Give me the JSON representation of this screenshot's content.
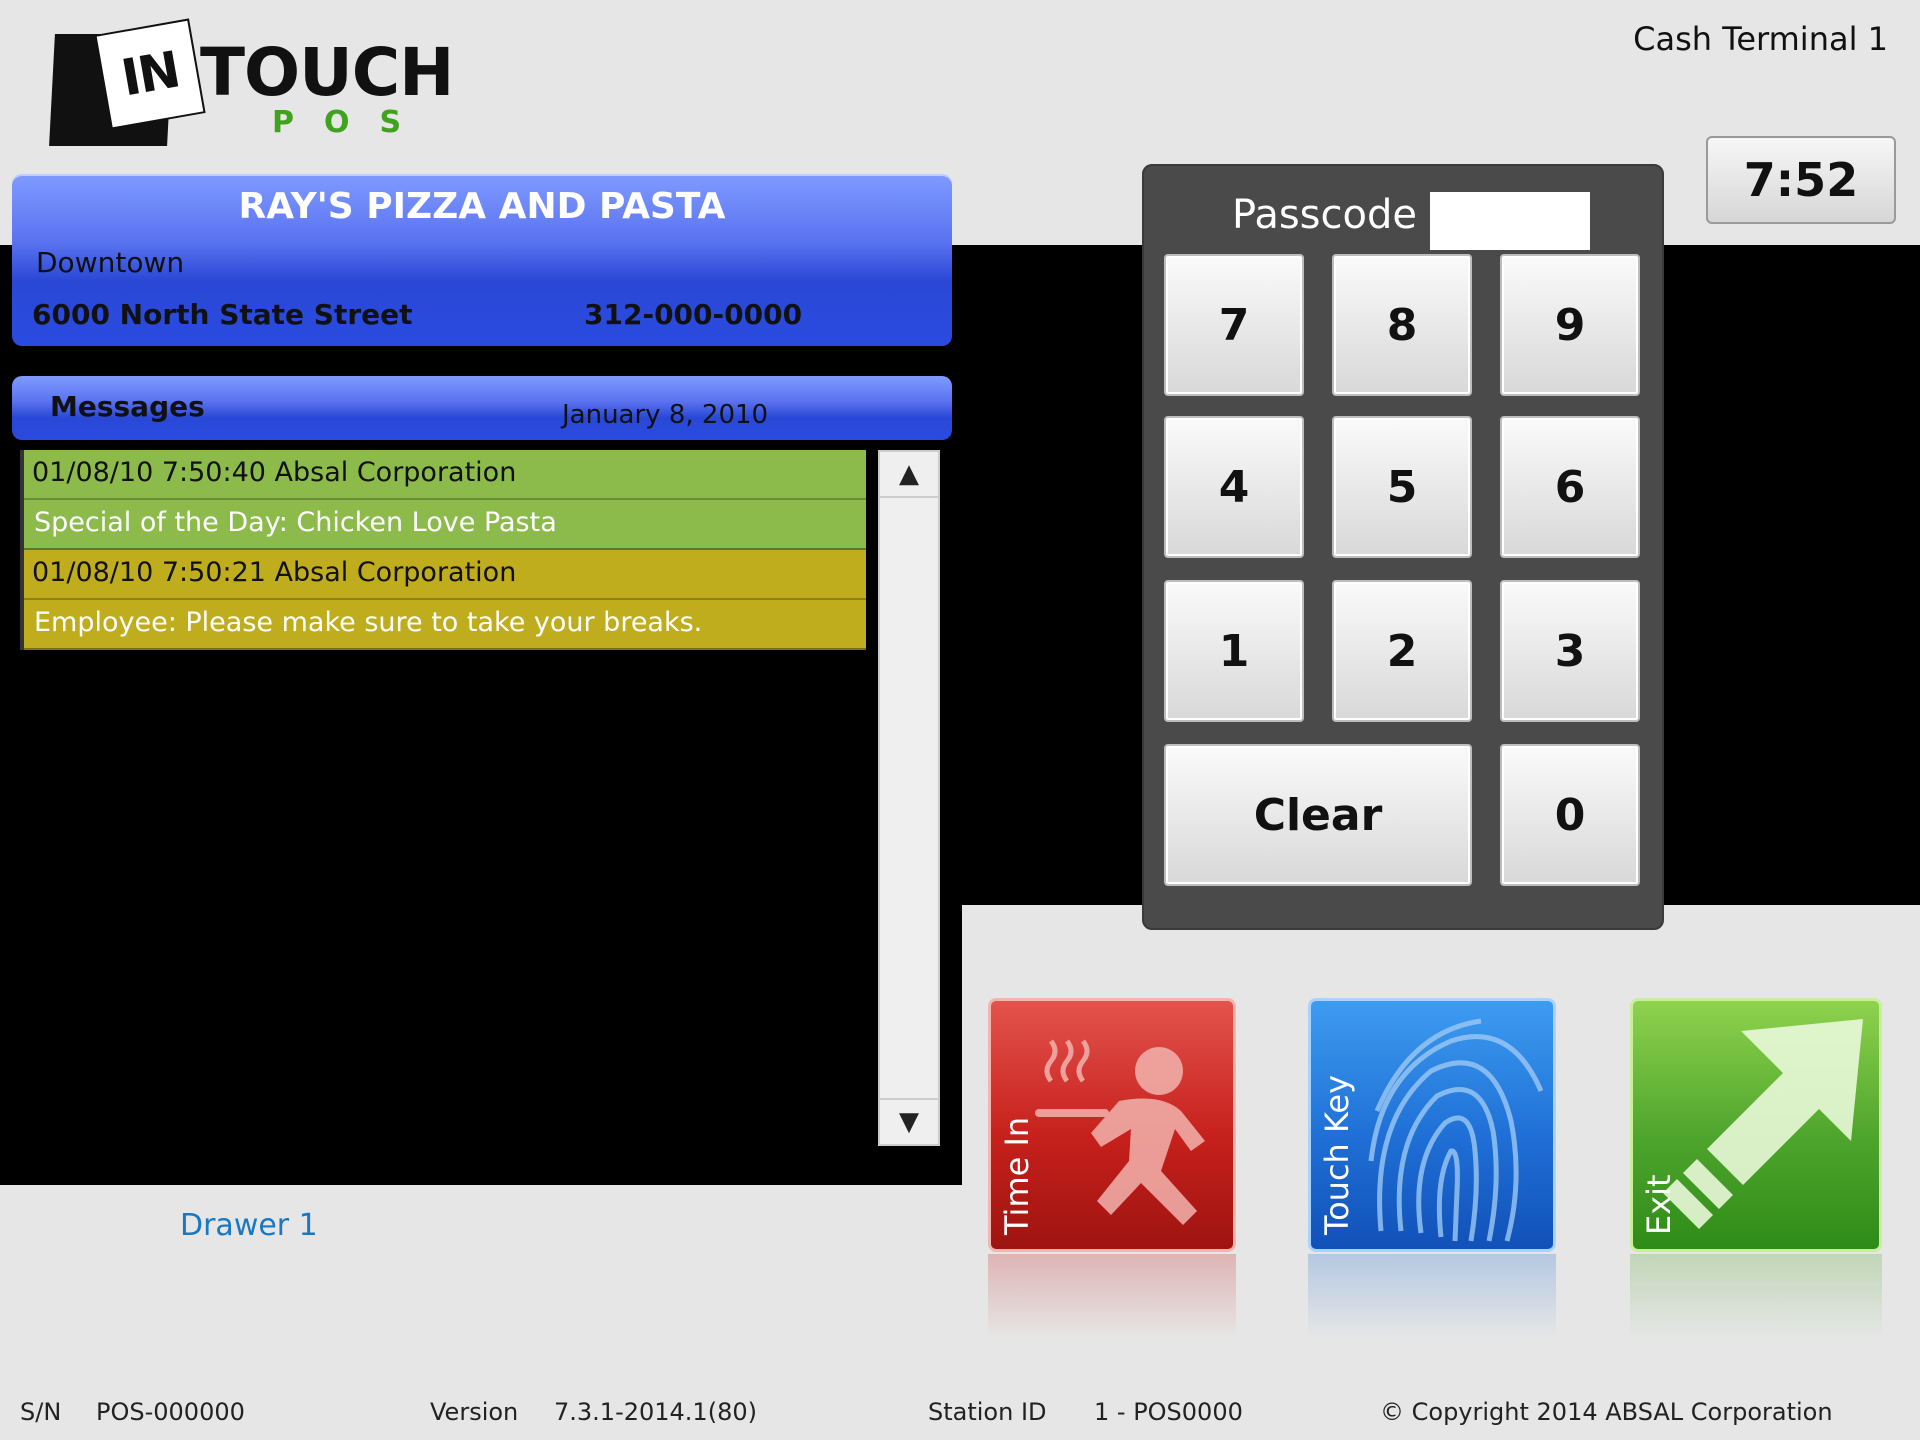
{
  "header": {
    "logo_in": "IN",
    "logo_touch": "TOUCH",
    "logo_pos": "POS",
    "terminal_name": "Cash Terminal 1",
    "clock": "7:52"
  },
  "store": {
    "name": "RAY'S PIZZA AND PASTA",
    "area": "Downtown",
    "address": "6000 North State Street",
    "phone": "312-000-0000"
  },
  "messages": {
    "title": "Messages",
    "date": "January 8, 2010",
    "items": [
      {
        "header": "01/08/10 7:50:40 Absal Corporation",
        "body": "Special of the Day:  Chicken Love Pasta",
        "color": "#8dbb4b"
      },
      {
        "header": "01/08/10 7:50:21 Absal Corporation",
        "body": "Employee:  Please make sure to take your breaks.",
        "color": "#c0ad1e"
      }
    ],
    "scroll_up": "▲",
    "scroll_down": "▼"
  },
  "drawer": "Drawer 1",
  "keypad": {
    "label": "Passcode",
    "value": "",
    "keys": [
      "7",
      "8",
      "9",
      "4",
      "5",
      "6",
      "1",
      "2",
      "3"
    ],
    "clear": "Clear",
    "zero": "0"
  },
  "actions": {
    "time_in": "Time In",
    "touch_key": "Touch Key",
    "exit": "Exit",
    "colors": {
      "time_in": "#c6201c",
      "touch_key": "#1f6fd6",
      "exit": "#4ea52c"
    }
  },
  "footer": {
    "sn_label": "S/N",
    "sn_value": "POS-000000",
    "version_label": "Version",
    "version_value": "7.3.1-2014.1(80)",
    "station_label": "Station ID",
    "station_value": "1 - POS0000",
    "copyright": "© Copyright 2014 ABSAL Corporation"
  }
}
